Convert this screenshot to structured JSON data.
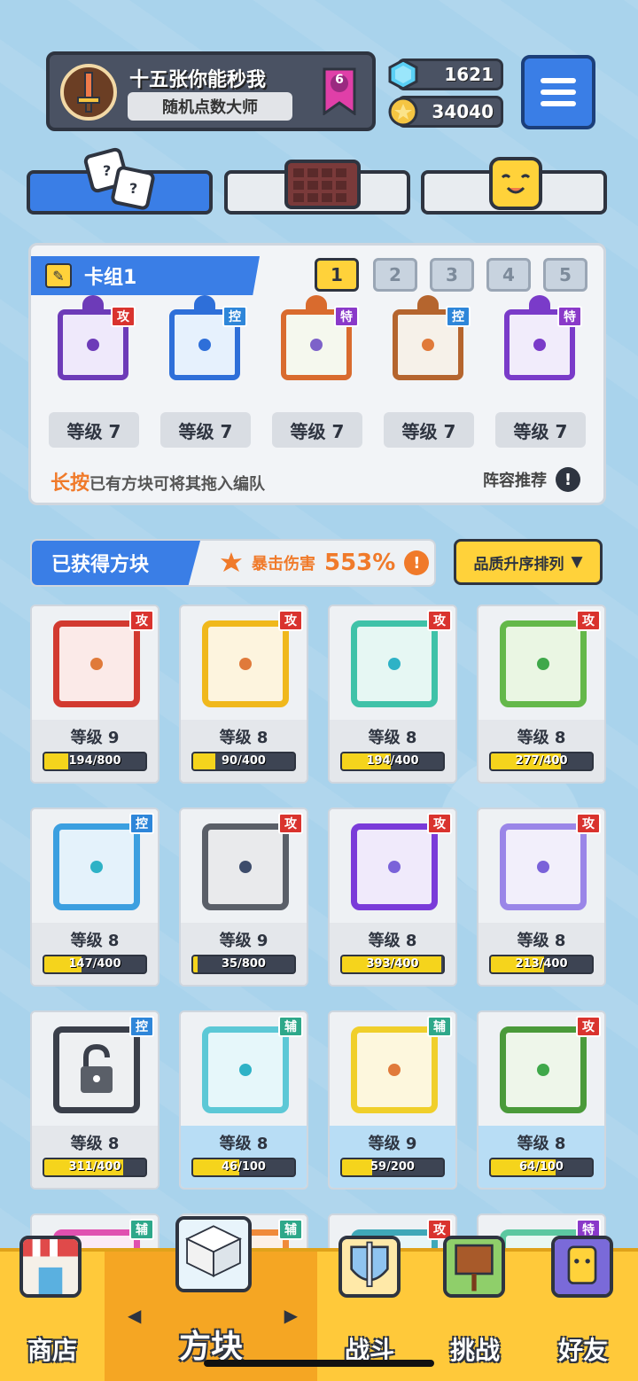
{
  "profile": {
    "name": "十五张你能秒我",
    "title": "随机点数大师",
    "rank": "6",
    "gems": "1621",
    "coins": "34040"
  },
  "deck": {
    "label": "卡组1",
    "slots": [
      "1",
      "2",
      "3",
      "4",
      "5"
    ],
    "cards": [
      {
        "tag": "攻",
        "level": "等级 7",
        "color": "#6d3bb8",
        "bg": "#efe9fb",
        "dot": "#6d3bb8"
      },
      {
        "tag": "控",
        "level": "等级 7",
        "color": "#2e6fd9",
        "bg": "#e6f1fd",
        "dot": "#2e6fd9"
      },
      {
        "tag": "特",
        "level": "等级 7",
        "color": "#d96b2e",
        "bg": "#f5f8ee",
        "dot": "#7d62c9"
      },
      {
        "tag": "控",
        "level": "等级 7",
        "color": "#b5652e",
        "bg": "#f6f1e9",
        "dot": "#e07a3a"
      },
      {
        "tag": "特",
        "level": "等级 7",
        "color": "#7a3bc9",
        "bg": "#f1ecfb",
        "dot": "#7a3bc9"
      }
    ],
    "hint_emphasis": "长按",
    "hint_text": "已有方块可将其拖入编队",
    "recommend": "阵容推荐",
    "exclaim": "!"
  },
  "obtained": {
    "label": "已获得方块",
    "crit_label": "暴击伤害",
    "crit_value": "553%",
    "exclaim": "!",
    "sort_label": "品质升序排列",
    "sort_arrow": "▼"
  },
  "blocks": [
    {
      "tag": "攻",
      "level": "等级 9",
      "progress": "194/800",
      "fill": 0.24,
      "color": "#d23a30",
      "bg": "#fbeae8",
      "dot": "#e07a3a"
    },
    {
      "tag": "攻",
      "level": "等级 8",
      "progress": "90/400",
      "fill": 0.22,
      "color": "#f0b81c",
      "bg": "#fdf4de",
      "dot": "#e07a3a"
    },
    {
      "tag": "攻",
      "level": "等级 8",
      "progress": "194/400",
      "fill": 0.48,
      "color": "#3fc2a8",
      "bg": "#e6f7f3",
      "dot": "#2eb2c6"
    },
    {
      "tag": "攻",
      "level": "等级 8",
      "progress": "277/400",
      "fill": 0.69,
      "color": "#64b84a",
      "bg": "#eaf6e3",
      "dot": "#3fa84a"
    },
    {
      "tag": "控",
      "level": "等级 8",
      "progress": "147/400",
      "fill": 0.37,
      "color": "#3b9fe0",
      "bg": "#e4f2fb",
      "dot": "#2eb2c6"
    },
    {
      "tag": "攻",
      "level": "等级 9",
      "progress": "35/800",
      "fill": 0.04,
      "color": "#5a5f68",
      "bg": "#e9eaec",
      "dot": "#3d4c6b"
    },
    {
      "tag": "攻",
      "level": "等级 8",
      "progress": "393/400",
      "fill": 0.98,
      "color": "#7a3bd9",
      "bg": "#f0eafb",
      "dot": "#7a62d9"
    },
    {
      "tag": "攻",
      "level": "等级 8",
      "progress": "213/400",
      "fill": 0.53,
      "color": "#9a86e8",
      "bg": "#f2effb",
      "dot": "#7a62d9"
    },
    {
      "tag": "控",
      "level": "等级 8",
      "progress": "311/400",
      "fill": 0.78,
      "color": "#3a3f4a",
      "bg": "#eef0f2",
      "dot": "#3a3f4a",
      "locked": true
    },
    {
      "tag": "辅",
      "level": "等级 8",
      "progress": "46/100",
      "fill": 0.46,
      "color": "#5cc8d6",
      "bg": "#e6f7fa",
      "dot": "#2eb2c6",
      "highlight": true
    },
    {
      "tag": "辅",
      "level": "等级 9",
      "progress": "59/200",
      "fill": 0.3,
      "color": "#f0cf2a",
      "bg": "#fdf7dd",
      "dot": "#e07a3a",
      "highlight": true
    },
    {
      "tag": "攻",
      "level": "等级 8",
      "progress": "64/100",
      "fill": 0.64,
      "color": "#4a9a3a",
      "bg": "#eef6ea",
      "dot": "#3fa84a",
      "highlight": true
    },
    {
      "tag": "辅",
      "level": "",
      "progress": "",
      "fill": 0,
      "color": "#e050b0",
      "bg": "#fbeaf5",
      "dot": "#e050b0"
    },
    {
      "tag": "辅",
      "level": "",
      "progress": "",
      "fill": 0,
      "color": "#f08a3a",
      "bg": "#fdf0e6",
      "dot": "#e07a3a"
    },
    {
      "tag": "攻",
      "level": "",
      "progress": "",
      "fill": 0,
      "color": "#3fa8b8",
      "bg": "#e6f6f8",
      "dot": "#2eb2c6"
    },
    {
      "tag": "特",
      "level": "",
      "progress": "",
      "fill": 0,
      "color": "#5cc8a0",
      "bg": "#e8f8f2",
      "dot": "#3fa84a"
    }
  ],
  "nav": {
    "shop": "商店",
    "blocks": "方块",
    "battle": "战斗",
    "challenge": "挑战",
    "friends": "好友",
    "arrow_left": "◀",
    "arrow_right": "▶"
  }
}
